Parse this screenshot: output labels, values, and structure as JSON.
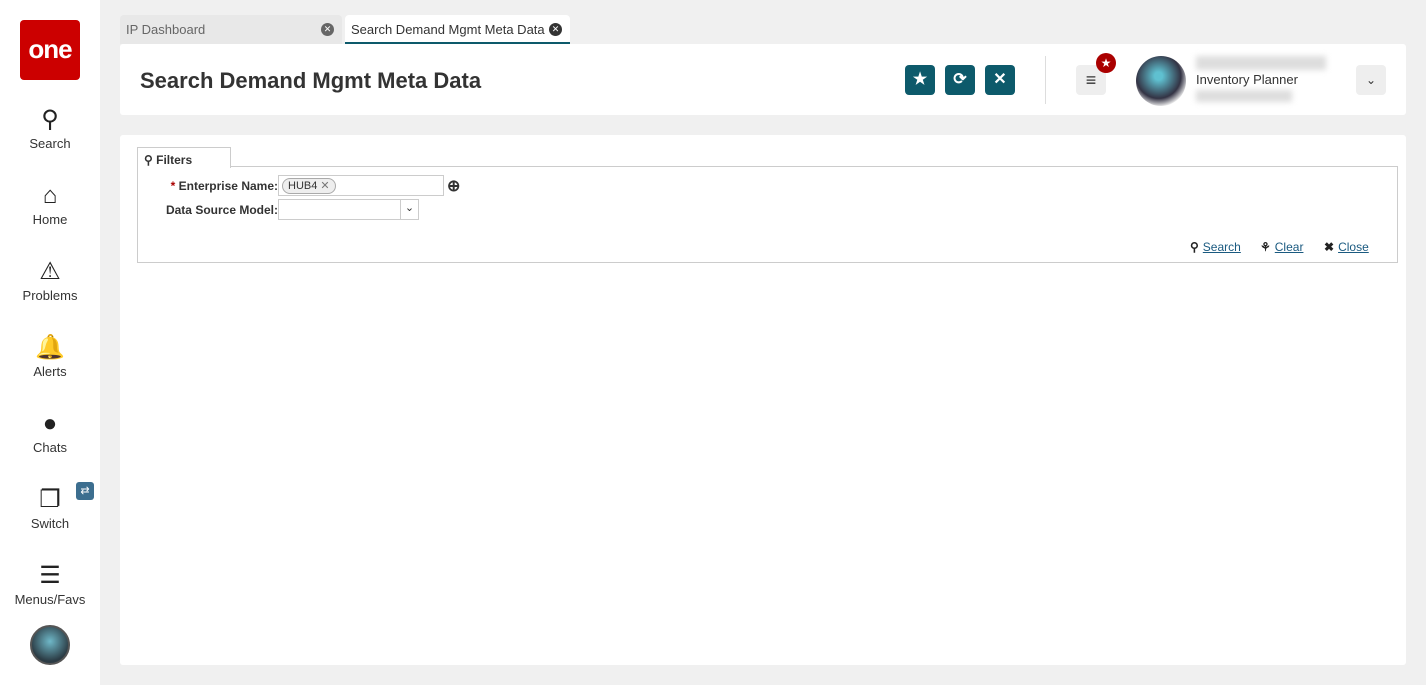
{
  "sidebar": {
    "logo": "one",
    "items": [
      {
        "label": "Search",
        "icon": "search-icon"
      },
      {
        "label": "Home",
        "icon": "home-icon"
      },
      {
        "label": "Problems",
        "icon": "warning-icon"
      },
      {
        "label": "Alerts",
        "icon": "bell-icon"
      },
      {
        "label": "Chats",
        "icon": "chat-icon"
      },
      {
        "label": "Switch",
        "icon": "switch-icon"
      },
      {
        "label": "Menus/Favs",
        "icon": "menu-icon"
      }
    ]
  },
  "tabs": [
    {
      "label": "IP Dashboard",
      "active": false
    },
    {
      "label": "Search Demand Mgmt Meta Data",
      "active": true
    }
  ],
  "header": {
    "title": "Search Demand Mgmt Meta Data",
    "user_role": "Inventory Planner",
    "accent": "#0d5a6b",
    "badge_color": "#aa0000"
  },
  "filters": {
    "tab_label": "Filters",
    "enterprise_label": "Enterprise Name:",
    "enterprise_chip": "HUB4",
    "data_source_label": "Data Source Model:",
    "data_source_value": "",
    "search": "Search",
    "clear": "Clear",
    "close": "Close"
  }
}
